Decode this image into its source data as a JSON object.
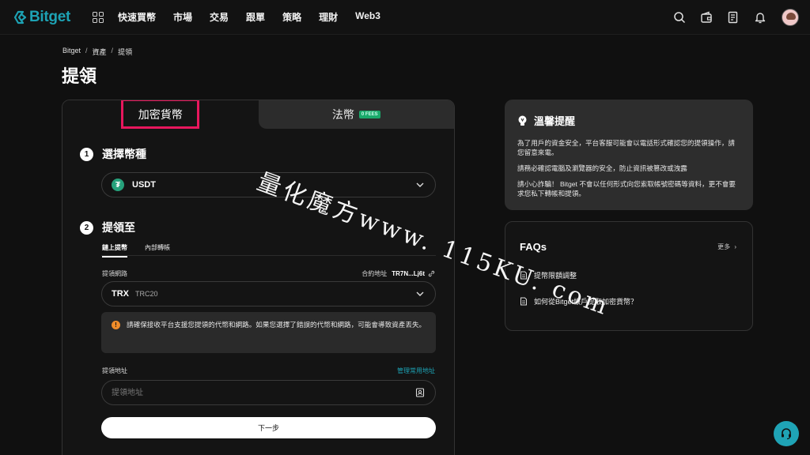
{
  "brand": {
    "name": "Bitget",
    "accent": "#1da2b4"
  },
  "nav": {
    "items": [
      "快速買幣",
      "市場",
      "交易",
      "跟單",
      "策略",
      "理財",
      "Web3"
    ]
  },
  "breadcrumb": [
    "Bitget",
    "資產",
    "提領"
  ],
  "page_title": "提領",
  "tabs": {
    "crypto": "加密貨幣",
    "fiat": "法幣",
    "fees_badge": "0 FEES"
  },
  "step1": {
    "number": "1",
    "label": "選擇幣種",
    "coin": "USDT",
    "coin_symbol": "₮"
  },
  "step2": {
    "number": "2",
    "label": "提領至",
    "subtabs": [
      "鏈上提幣",
      "內部轉帳"
    ],
    "network_label": "提領網路",
    "contract_label": "合約地址",
    "contract_value": "TR7N...Lj6t",
    "network_main": "TRX",
    "network_sub": "TRC20",
    "warning": "請確保接收平台支援您提領的代幣和網路。如果您選擇了錯誤的代幣和網路，可能會導致資產丟失。",
    "address_label": "提領地址",
    "manage_link": "管理常用地址",
    "address_placeholder": "提領地址",
    "next_button": "下一步"
  },
  "tips": {
    "title": "溫馨提醒",
    "paragraphs": [
      "為了用戶的資金安全，平台客服可能會以電話形式確認您的提領操作，請您留意來電。",
      "請務必確認電腦及瀏覽器的安全，防止資訊被篡改或洩露",
      "請小心詐騙！ Bitget 不會以任何形式向您索取帳號密碼等資料，更不會要求您私下轉帳和提領。"
    ]
  },
  "faq": {
    "title": "FAQs",
    "more": "更多",
    "items": [
      "提幣限額調整",
      "如何從Bitget帳戶提取加密貨幣？"
    ]
  },
  "watermark": "量化魔方www. 115KU. com"
}
